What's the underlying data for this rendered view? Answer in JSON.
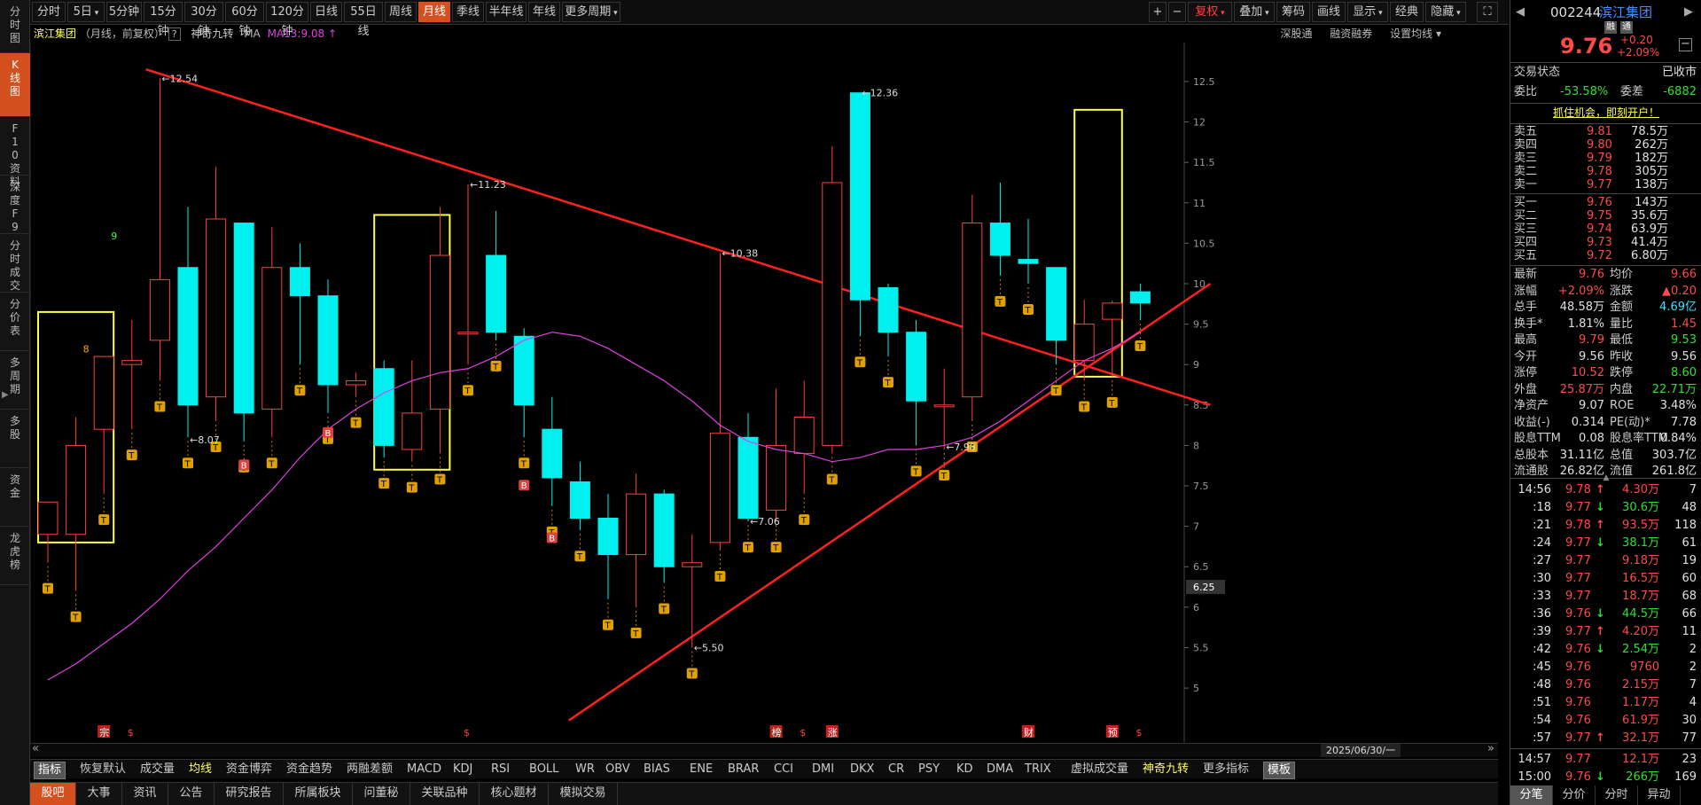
{
  "left_nav": [
    {
      "label": "分时图"
    },
    {
      "label": "K线图",
      "active": true
    },
    {
      "label": "F10资料"
    },
    {
      "label": "深度F9"
    },
    {
      "label": "分时成交"
    },
    {
      "label": "分价表"
    },
    {
      "label": "多周期"
    },
    {
      "label": "多股"
    },
    {
      "label": "资金"
    },
    {
      "label": "龙虎榜"
    }
  ],
  "toolbar": {
    "periods": [
      "分时",
      "5日",
      "5分钟",
      "15分钟",
      "30分钟",
      "60分钟",
      "120分钟",
      "日线",
      "55日线",
      "周线",
      "月线",
      "季线",
      "半年线",
      "年线",
      "更多周期"
    ],
    "active_period": "月线",
    "plus": "+",
    "minus": "−",
    "fuquan": "复权",
    "overlay": "叠加",
    "chips": "筹码",
    "draw": "画线",
    "display": "显示",
    "classic": "经典",
    "hide": "隐藏",
    "expand": "⛶"
  },
  "chart_header": {
    "stock_name": "滨江集团",
    "desc": "（月线，前复权）",
    "help": "?",
    "indicator": "神奇九转",
    "ma_label": "MA",
    "ma_value": "MA13:9.08",
    "arrow": "↑",
    "right_opts": [
      "深股通",
      "融资融券",
      "设置均线"
    ]
  },
  "chart_data": {
    "type": "candlestick",
    "y_ticks": [
      5.0,
      5.5,
      6.0,
      6.5,
      7.0,
      7.5,
      8.0,
      8.5,
      9.0,
      9.5,
      10.0,
      10.5,
      11.0,
      11.5,
      12.0,
      12.5
    ],
    "current_price_tag": "6.25",
    "ylim": [
      4.65,
      12.85
    ],
    "candles": [
      {
        "o": 6.9,
        "h": 7.05,
        "l": 6.55,
        "c": 7.3
      },
      {
        "o": 6.9,
        "h": 8.35,
        "l": 6.2,
        "c": 8.0
      },
      {
        "o": 8.2,
        "h": 9.1,
        "l": 7.4,
        "c": 9.1
      },
      {
        "o": 9.0,
        "h": 9.55,
        "l": 8.2,
        "c": 9.05
      },
      {
        "o": 9.3,
        "h": 12.54,
        "l": 8.8,
        "c": 10.05
      },
      {
        "o": 10.2,
        "h": 10.95,
        "l": 8.1,
        "c": 8.5
      },
      {
        "o": 8.6,
        "h": 11.45,
        "l": 8.3,
        "c": 10.8
      },
      {
        "o": 10.75,
        "h": 10.75,
        "l": 8.05,
        "c": 8.4
      },
      {
        "o": 8.45,
        "h": 10.7,
        "l": 8.1,
        "c": 10.2
      },
      {
        "o": 10.2,
        "h": 10.5,
        "l": 9.0,
        "c": 9.85
      },
      {
        "o": 9.85,
        "h": 10.05,
        "l": 8.4,
        "c": 8.75
      },
      {
        "o": 8.75,
        "h": 8.9,
        "l": 8.6,
        "c": 8.8
      },
      {
        "o": 8.95,
        "h": 9.05,
        "l": 7.85,
        "c": 8.0
      },
      {
        "o": 7.95,
        "h": 9.05,
        "l": 7.8,
        "c": 8.4
      },
      {
        "o": 8.45,
        "h": 10.95,
        "l": 7.9,
        "c": 10.35
      },
      {
        "o": 9.4,
        "h": 11.23,
        "l": 9.0,
        "c": 9.4
      },
      {
        "o": 10.35,
        "h": 10.9,
        "l": 9.3,
        "c": 9.4
      },
      {
        "o": 9.35,
        "h": 9.45,
        "l": 8.1,
        "c": 8.5
      },
      {
        "o": 8.2,
        "h": 8.6,
        "l": 7.25,
        "c": 7.6
      },
      {
        "o": 7.55,
        "h": 7.8,
        "l": 6.95,
        "c": 7.1
      },
      {
        "o": 7.1,
        "h": 7.4,
        "l": 6.1,
        "c": 6.65
      },
      {
        "o": 6.65,
        "h": 7.65,
        "l": 6.0,
        "c": 7.4
      },
      {
        "o": 7.4,
        "h": 7.45,
        "l": 6.3,
        "c": 6.5
      },
      {
        "o": 6.5,
        "h": 6.9,
        "l": 5.5,
        "c": 6.55
      },
      {
        "o": 6.8,
        "h": 10.38,
        "l": 6.7,
        "c": 8.15
      },
      {
        "o": 8.1,
        "h": 8.4,
        "l": 7.06,
        "c": 7.1
      },
      {
        "o": 7.2,
        "h": 8.7,
        "l": 7.06,
        "c": 8.0
      },
      {
        "o": 7.9,
        "h": 8.8,
        "l": 7.4,
        "c": 8.35
      },
      {
        "o": 8.0,
        "h": 11.7,
        "l": 7.9,
        "c": 11.25
      },
      {
        "o": 12.36,
        "h": 12.36,
        "l": 9.35,
        "c": 9.8
      },
      {
        "o": 9.95,
        "h": 10.0,
        "l": 9.1,
        "c": 9.4
      },
      {
        "o": 9.4,
        "h": 9.55,
        "l": 8.0,
        "c": 8.55
      },
      {
        "o": 8.5,
        "h": 8.95,
        "l": 7.95,
        "c": 8.5
      },
      {
        "o": 8.6,
        "h": 11.1,
        "l": 8.3,
        "c": 10.75
      },
      {
        "o": 10.75,
        "h": 11.25,
        "l": 10.1,
        "c": 10.35
      },
      {
        "o": 10.3,
        "h": 10.8,
        "l": 10.0,
        "c": 10.25
      },
      {
        "o": 10.2,
        "h": 10.2,
        "l": 9.0,
        "c": 9.3
      },
      {
        "o": 9.05,
        "h": 9.8,
        "l": 8.8,
        "c": 9.5
      },
      {
        "o": 9.56,
        "h": 9.79,
        "l": 8.85,
        "c": 9.76
      },
      {
        "o": 9.9,
        "h": 10.0,
        "l": 9.55,
        "c": 9.76
      }
    ],
    "ma13": [
      5.1,
      5.3,
      5.55,
      5.8,
      6.1,
      6.45,
      6.75,
      7.1,
      7.45,
      7.85,
      8.2,
      8.45,
      8.65,
      8.8,
      8.9,
      8.95,
      9.1,
      9.3,
      9.4,
      9.35,
      9.2,
      9.0,
      8.8,
      8.55,
      8.25,
      8.05,
      7.95,
      7.9,
      7.8,
      7.85,
      7.95,
      7.95,
      8.0,
      8.1,
      8.3,
      8.55,
      8.8,
      9.05,
      9.2,
      9.4
    ],
    "annotations": [
      {
        "text": "←12.54"
      },
      {
        "text": "←8.07"
      },
      {
        "text": "←11.23"
      },
      {
        "text": "←10.38"
      },
      {
        "text": "←7.06"
      },
      {
        "text": "←5.50"
      },
      {
        "text": "←12.36"
      },
      {
        "text": "←7.98"
      }
    ],
    "setup_numbers": [
      "8",
      "9"
    ],
    "bottom_markers": [
      "宗",
      "$",
      "$",
      "榜",
      "$",
      "涨",
      "财",
      "预",
      "$"
    ],
    "date_label": "2025/06/30/一"
  },
  "scroll": {
    "left": "«",
    "right": "»"
  },
  "indicators": [
    "指标",
    "恢复默认",
    "成交量",
    "均线",
    "资金博弈",
    "资金趋势",
    "两融差额",
    "MACD",
    "KDJ",
    "RSI",
    "BOLL",
    "WR",
    "OBV",
    "BIAS",
    "ENE",
    "BRAR",
    "CCI",
    "DMI",
    "DKX",
    "CR",
    "PSY",
    "KD",
    "DMA",
    "TRIX",
    "虚拟成交量",
    "神奇九转",
    "更多指标",
    "模板"
  ],
  "bottom_nav": [
    "股吧",
    "大事",
    "资讯",
    "公告",
    "研究报告",
    "所属板块",
    "问董秘",
    "关联品种",
    "核心题材",
    "模拟交易"
  ],
  "quote": {
    "code": "002244",
    "name": "滨江集团",
    "tags": [
      "融",
      "通"
    ],
    "price": "9.76",
    "change": "+0.20",
    "pct": "+2.09%",
    "status_label": "交易状态",
    "status": "已收市",
    "weibi_label": "委比",
    "weibi": "-53.58%",
    "weicha_label": "委差",
    "weicha": "-6882",
    "ad": "抓住机会，即刻开户！",
    "asks": [
      {
        "label": "卖五",
        "price": "9.81",
        "vol": "78.5万"
      },
      {
        "label": "卖四",
        "price": "9.80",
        "vol": "262万"
      },
      {
        "label": "卖三",
        "price": "9.79",
        "vol": "182万"
      },
      {
        "label": "卖二",
        "price": "9.78",
        "vol": "305万"
      },
      {
        "label": "卖一",
        "price": "9.77",
        "vol": "138万"
      }
    ],
    "bids": [
      {
        "label": "买一",
        "price": "9.76",
        "vol": "143万"
      },
      {
        "label": "买二",
        "price": "9.75",
        "vol": "35.6万"
      },
      {
        "label": "买三",
        "price": "9.74",
        "vol": "63.9万"
      },
      {
        "label": "买四",
        "price": "9.73",
        "vol": "41.4万"
      },
      {
        "label": "买五",
        "price": "9.72",
        "vol": "6.80万"
      }
    ],
    "stats": [
      {
        "l1": "最新",
        "v1": "9.76",
        "c1": "red",
        "l2": "均价",
        "v2": "9.66",
        "c2": "red"
      },
      {
        "l1": "涨幅",
        "v1": "+2.09%",
        "c1": "red",
        "l2": "涨跌",
        "v2": "▲0.20",
        "c2": "red"
      },
      {
        "l1": "总手",
        "v1": "48.58万",
        "c1": "wht",
        "l2": "金额",
        "v2": "4.69亿",
        "c2": "cyan"
      },
      {
        "l1": "换手*",
        "v1": "1.81%",
        "c1": "wht",
        "l2": "量比",
        "v2": "1.45",
        "c2": "red"
      },
      {
        "l1": "最高",
        "v1": "9.79",
        "c1": "red",
        "l2": "最低",
        "v2": "9.53",
        "c2": "grn"
      },
      {
        "l1": "今开",
        "v1": "9.56",
        "c1": "wht",
        "l2": "昨收",
        "v2": "9.56",
        "c2": "wht"
      },
      {
        "l1": "涨停",
        "v1": "10.52",
        "c1": "red",
        "l2": "跌停",
        "v2": "8.60",
        "c2": "grn"
      },
      {
        "l1": "外盘",
        "v1": "25.87万",
        "c1": "red",
        "l2": "内盘",
        "v2": "22.71万",
        "c2": "grn"
      },
      {
        "l1": "净资产",
        "v1": "9.07",
        "c1": "wht",
        "l2": "ROE",
        "v2": "3.48%",
        "c2": "wht"
      },
      {
        "l1": "收益(-)",
        "v1": "0.314",
        "c1": "wht",
        "l2": "PE(动)*",
        "v2": "7.78",
        "c2": "wht"
      },
      {
        "l1": "股息TTM",
        "v1": "0.08",
        "c1": "wht",
        "l2": "股息率TTM",
        "v2": "0.84%",
        "c2": "wht"
      },
      {
        "l1": "总股本",
        "v1": "31.11亿",
        "c1": "wht",
        "l2": "总值",
        "v2": "303.7亿",
        "c2": "wht"
      },
      {
        "l1": "流通股",
        "v1": "26.82亿",
        "c1": "wht",
        "l2": "流值",
        "v2": "261.8亿",
        "c2": "wht"
      }
    ],
    "ticks": [
      {
        "t": "14:56",
        "p": "9.78",
        "a": "↑",
        "ac": "red",
        "v": "4.30万",
        "n": "7",
        "pc": "red"
      },
      {
        "t": ":18",
        "p": "9.77",
        "a": "↓",
        "ac": "grn",
        "v": "30.6万",
        "n": "48",
        "pc": "red"
      },
      {
        "t": ":21",
        "p": "9.78",
        "a": "↑",
        "ac": "red",
        "v": "93.5万",
        "n": "118",
        "pc": "red"
      },
      {
        "t": ":24",
        "p": "9.77",
        "a": "↓",
        "ac": "grn",
        "v": "38.1万",
        "n": "61",
        "pc": "red"
      },
      {
        "t": ":27",
        "p": "9.77",
        "a": "",
        "ac": "",
        "v": "9.18万",
        "n": "19",
        "pc": "red"
      },
      {
        "t": ":30",
        "p": "9.77",
        "a": "",
        "ac": "",
        "v": "16.5万",
        "n": "60",
        "pc": "red"
      },
      {
        "t": ":33",
        "p": "9.77",
        "a": "",
        "ac": "",
        "v": "18.7万",
        "n": "68",
        "pc": "red"
      },
      {
        "t": ":36",
        "p": "9.76",
        "a": "↓",
        "ac": "grn",
        "v": "44.5万",
        "n": "66",
        "pc": "red"
      },
      {
        "t": ":39",
        "p": "9.77",
        "a": "↑",
        "ac": "red",
        "v": "4.20万",
        "n": "11",
        "pc": "red"
      },
      {
        "t": ":42",
        "p": "9.76",
        "a": "↓",
        "ac": "grn",
        "v": "2.54万",
        "n": "2",
        "pc": "red"
      },
      {
        "t": ":45",
        "p": "9.76",
        "a": "",
        "ac": "",
        "v": "9760",
        "n": "2",
        "pc": "red"
      },
      {
        "t": ":48",
        "p": "9.76",
        "a": "",
        "ac": "",
        "v": "2.15万",
        "n": "7",
        "pc": "red"
      },
      {
        "t": ":51",
        "p": "9.76",
        "a": "",
        "ac": "",
        "v": "1.17万",
        "n": "4",
        "pc": "red"
      },
      {
        "t": ":54",
        "p": "9.76",
        "a": "",
        "ac": "",
        "v": "61.9万",
        "n": "30",
        "pc": "red"
      },
      {
        "t": ":57",
        "p": "9.77",
        "a": "↑",
        "ac": "red",
        "v": "32.1万",
        "n": "77",
        "pc": "red"
      },
      {
        "t": "14:57",
        "p": "9.77",
        "a": "",
        "ac": "",
        "v": "12.1万",
        "n": "23",
        "pc": "red"
      },
      {
        "t": "15:00",
        "p": "9.76",
        "a": "↓",
        "ac": "grn",
        "v": "266万",
        "n": "169",
        "pc": "red"
      }
    ],
    "tabs": [
      "分笔",
      "分价",
      "分时",
      "异动"
    ]
  }
}
